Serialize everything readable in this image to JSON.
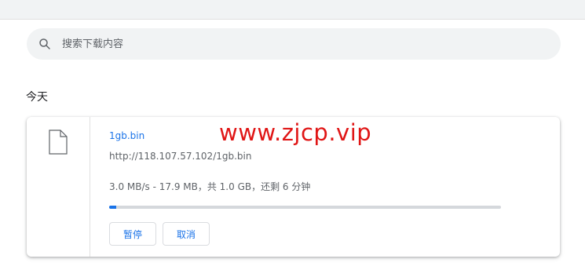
{
  "search": {
    "placeholder": "搜索下载内容",
    "value": ""
  },
  "section": {
    "date_label": "今天"
  },
  "download": {
    "filename": "1gb.bin",
    "url": "http://118.107.57.102/1gb.bin",
    "status": "3.0 MB/s - 17.9 MB，共 1.0 GB，还剩 6 分钟",
    "progress_percent": 1.79,
    "pause_label": "暂停",
    "cancel_label": "取消"
  },
  "watermark": "www.zjcp.vip",
  "colors": {
    "accent": "#1a73e8",
    "watermark": "#e01515"
  },
  "icons": {
    "search": "search-icon",
    "file": "file-icon"
  }
}
